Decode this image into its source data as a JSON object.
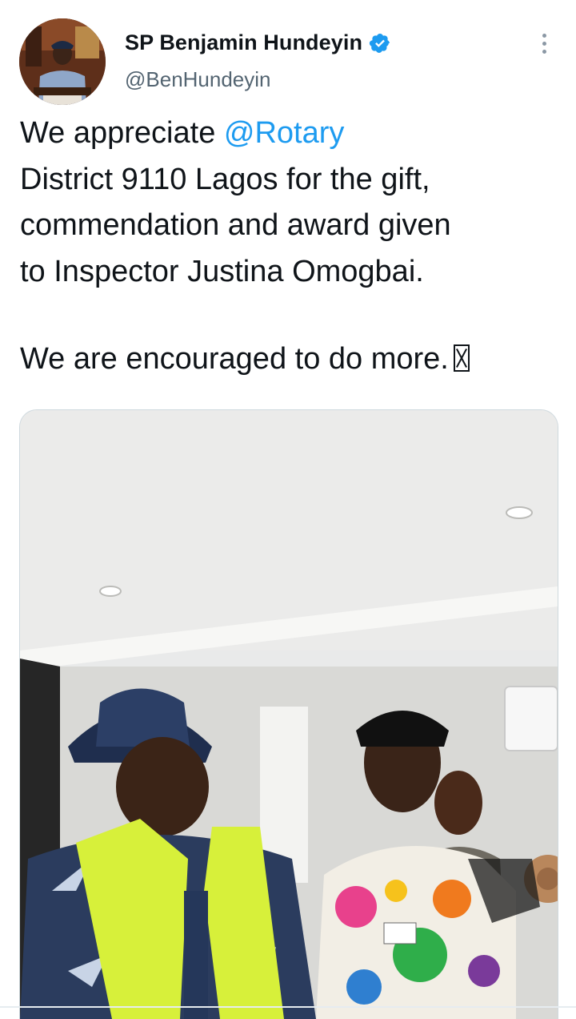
{
  "author": {
    "display_name": "SP Benjamin Hundeyin",
    "handle": "@BenHundeyin",
    "verified": true,
    "avatar_icon": "profile-photo",
    "verified_color": "#1d9bf0"
  },
  "menu": {
    "icon": "more-vertical-icon"
  },
  "tweet": {
    "text_before_mention": "We appreciate ",
    "mention": "@Rotary",
    "text_after_mention": "\nDistrict 9110 Lagos for the gift,\ncommendation and award given\nto Inspector Justina Omogbai.",
    "second_paragraph": "We are encouraged to do more.",
    "trailing_emoji": "unrendered-emoji-glyph"
  },
  "media": {
    "type": "photo",
    "description_icon": "tweet-photo"
  },
  "colors": {
    "link": "#1d9bf0",
    "text": "#0f1419",
    "secondary_text": "#536471"
  }
}
